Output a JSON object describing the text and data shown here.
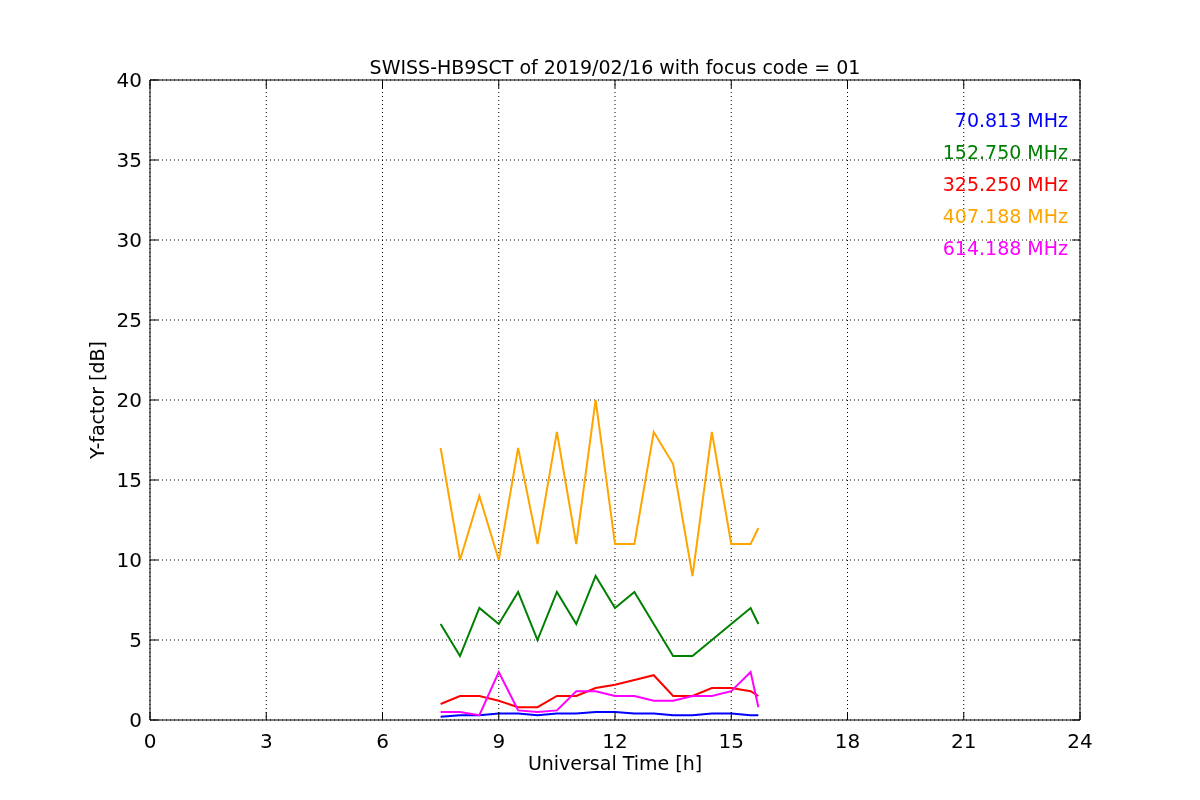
{
  "figure": {
    "chart_data": {
      "type": "line",
      "title": "SWISS-HB9SCT of 2019/02/16 with focus code = 01",
      "xlabel": "Universal Time [h]",
      "ylabel": "Y-factor [dB]",
      "x": [
        7.5,
        8,
        8.5,
        9,
        9.5,
        10,
        10.5,
        11,
        11.5,
        12,
        12.5,
        13,
        13.5,
        14,
        14.5,
        15,
        15.5,
        15.7
      ],
      "series": [
        {
          "name": "70.813 MHz",
          "color": "#0000ff",
          "values": [
            0.2,
            0.3,
            0.3,
            0.4,
            0.4,
            0.3,
            0.4,
            0.4,
            0.5,
            0.5,
            0.4,
            0.4,
            0.3,
            0.3,
            0.4,
            0.4,
            0.3,
            0.3
          ]
        },
        {
          "name": "152.750 MHz",
          "color": "#008000",
          "values": [
            6,
            4,
            7,
            6,
            8,
            5,
            8,
            6,
            9,
            7,
            8,
            6,
            4,
            4,
            5,
            6,
            7,
            6
          ]
        },
        {
          "name": "325.250 MHz",
          "color": "#ff0000",
          "values": [
            1,
            1.5,
            1.5,
            1.2,
            0.8,
            0.8,
            1.5,
            1.5,
            2,
            2.2,
            2.5,
            2.8,
            1.5,
            1.5,
            2,
            2,
            1.8,
            1.5
          ]
        },
        {
          "name": "407.188 MHz",
          "color": "#ffa500",
          "values": [
            17,
            10,
            14,
            10,
            17,
            11,
            18,
            11,
            20,
            11,
            11,
            18,
            16,
            9,
            18,
            11,
            11,
            12
          ]
        },
        {
          "name": "614.188 MHz",
          "color": "#ff00ff",
          "values": [
            0.5,
            0.5,
            0.3,
            3,
            0.6,
            0.5,
            0.6,
            1.8,
            1.8,
            1.5,
            1.5,
            1.2,
            1.2,
            1.5,
            1.5,
            1.8,
            3,
            0.8
          ]
        }
      ],
      "grid": true,
      "xlim": [
        0,
        24
      ],
      "ylim": [
        0,
        40
      ],
      "xticks": [
        0,
        3,
        6,
        9,
        12,
        15,
        18,
        21,
        24
      ],
      "yticks": [
        0,
        5,
        10,
        15,
        20,
        25,
        30,
        35,
        40
      ]
    }
  }
}
